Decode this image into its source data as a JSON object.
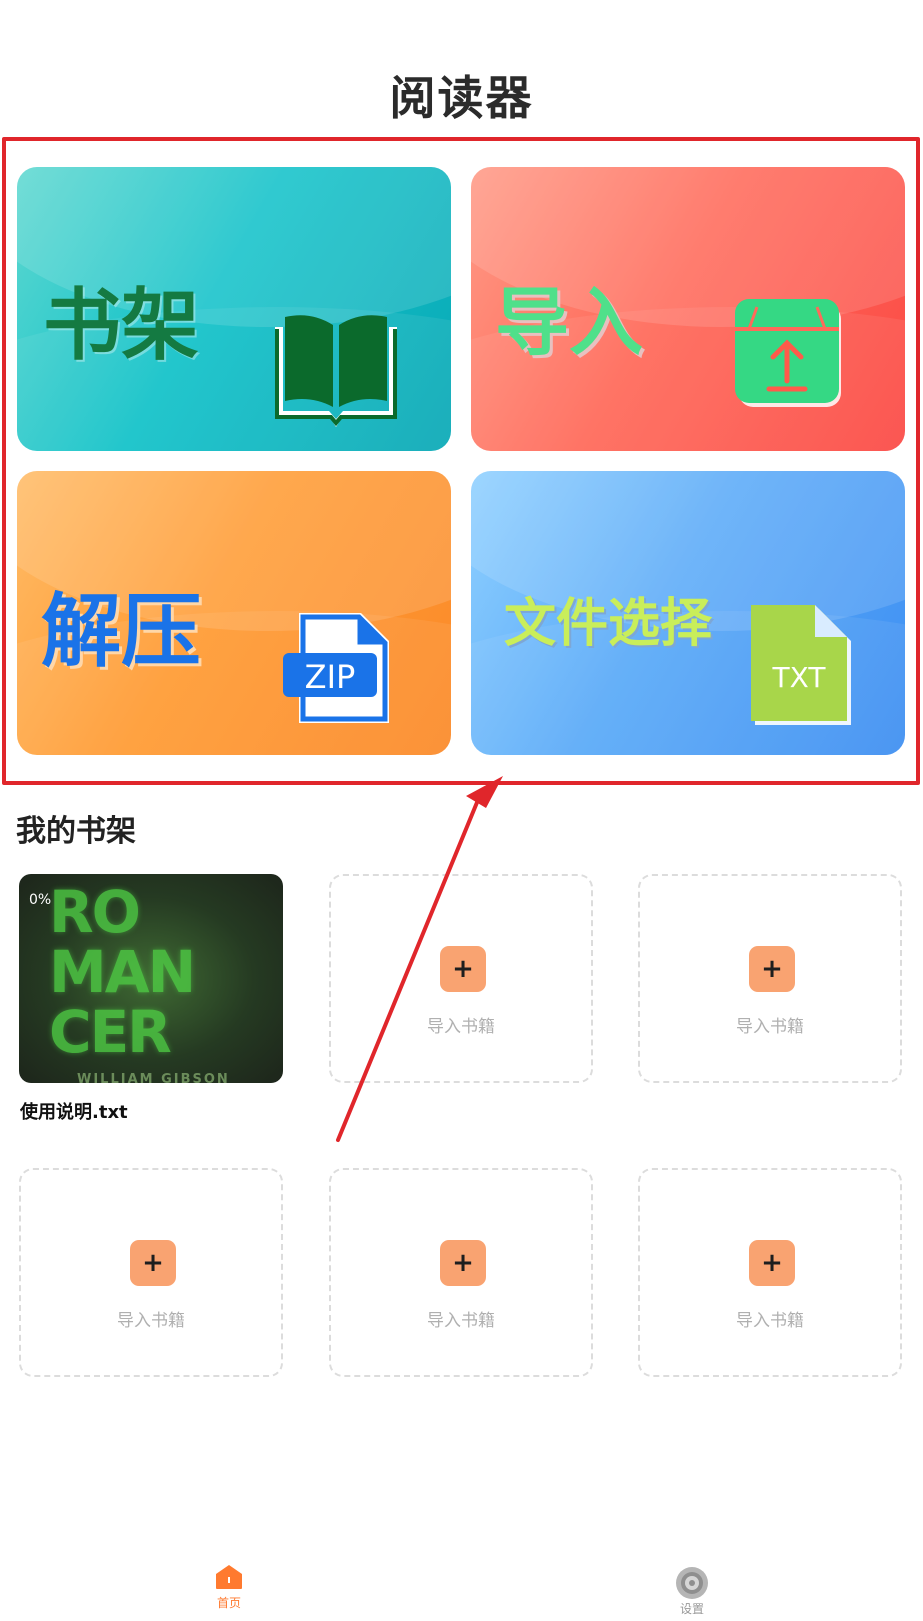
{
  "app": {
    "title": "阅读器"
  },
  "cards": [
    {
      "label": "书架",
      "icon": "book-icon"
    },
    {
      "label": "导入",
      "icon": "import-box-icon"
    },
    {
      "label": "解压",
      "icon": "zip-file-icon",
      "icon_text": "ZIP"
    },
    {
      "label": "文件选择",
      "icon": "txt-file-icon",
      "icon_text": "TXT"
    }
  ],
  "shelf": {
    "title": "我的书架",
    "book": {
      "title": "使用说明.txt",
      "progress": "0%",
      "cover_text": "RO MAN CER",
      "cover_author": "WILLIAM GIBSON"
    },
    "slot_label": "导入书籍",
    "slot_plus": "+"
  },
  "tabs": [
    {
      "label": "首页",
      "icon": "home-icon",
      "active": true
    },
    {
      "label": "设置",
      "icon": "settings-icon",
      "active": false
    }
  ],
  "colors": {
    "accent": "#ff7a2f",
    "highlight": "#e0262b",
    "plus_bg": "#f9a371"
  }
}
